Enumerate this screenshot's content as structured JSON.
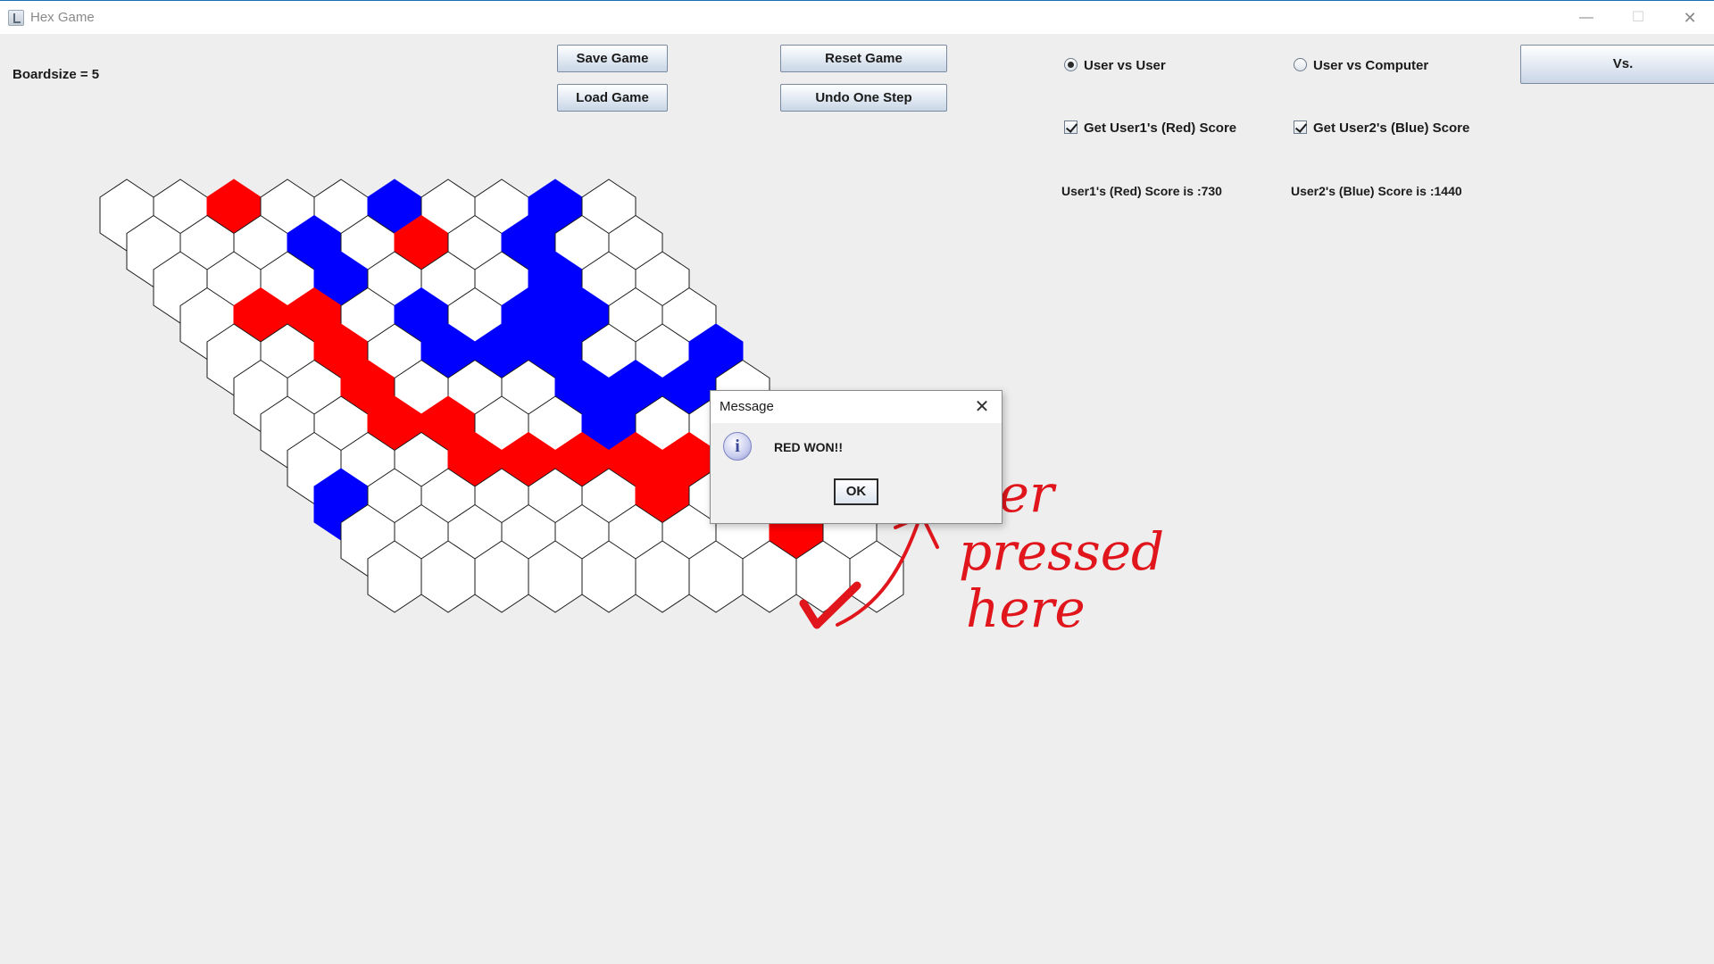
{
  "window": {
    "title": "Hex Game",
    "controls": {
      "minimize": "—",
      "maximize": "☐",
      "close": "✕"
    }
  },
  "toolbar": {
    "boardsize_label": "Boardsize = 5",
    "save_label": "Save Game",
    "load_label": "Load Game",
    "reset_label": "Reset Game",
    "undo_label": "Undo One Step",
    "vs_label": "Vs."
  },
  "modes": {
    "user_vs_user": {
      "label": "User vs User",
      "selected": true
    },
    "user_vs_computer": {
      "label": "User vs Computer",
      "selected": false
    }
  },
  "scores": {
    "get_red_label": "Get User1's (Red) Score",
    "get_red_checked": true,
    "get_blue_label": "Get User2's (Blue) Score",
    "get_blue_checked": true,
    "red_score_text": "User1's (Red) Score is :730",
    "blue_score_text": "User2's (Blue) Score is :1440"
  },
  "board": {
    "rows": 11,
    "cols": 10,
    "colors": {
      "red": "#ff0000",
      "blue": "#0000ff",
      "empty": "#ffffff",
      "stroke": "#1a1a1a"
    },
    "cells": [
      "..R..B..B.",
      "..........",
      "..........",
      "..........",
      "..........",
      "..........",
      "..........",
      "..........",
      "..........",
      "..........",
      ".........."
    ],
    "red": [
      [
        0,
        2
      ],
      [
        1,
        5
      ],
      [
        3,
        1
      ],
      [
        3,
        2
      ],
      [
        4,
        2
      ],
      [
        5,
        2
      ],
      [
        6,
        2
      ],
      [
        6,
        3
      ],
      [
        7,
        3
      ],
      [
        7,
        4
      ],
      [
        7,
        5
      ],
      [
        7,
        6
      ],
      [
        7,
        7
      ],
      [
        8,
        6
      ],
      [
        8,
        8
      ],
      [
        8,
        9
      ],
      [
        9,
        8
      ]
    ],
    "blue": [
      [
        0,
        5
      ],
      [
        0,
        8
      ],
      [
        1,
        3
      ],
      [
        1,
        7
      ],
      [
        2,
        3
      ],
      [
        2,
        7
      ],
      [
        3,
        4
      ],
      [
        3,
        6
      ],
      [
        3,
        7
      ],
      [
        4,
        4
      ],
      [
        4,
        5
      ],
      [
        4,
        6
      ],
      [
        4,
        9
      ],
      [
        5,
        6
      ],
      [
        5,
        7
      ],
      [
        5,
        8
      ],
      [
        6,
        6
      ],
      [
        8,
        0
      ]
    ]
  },
  "dialog": {
    "title": "Message",
    "close": "✕",
    "icon": "info-icon",
    "icon_glyph": "i",
    "message": "RED WON!!",
    "ok_label": "OK"
  },
  "annotation": {
    "text_line1": "After",
    "text_line2": "pressed",
    "text_line3": "here",
    "color": "#e0161c"
  }
}
